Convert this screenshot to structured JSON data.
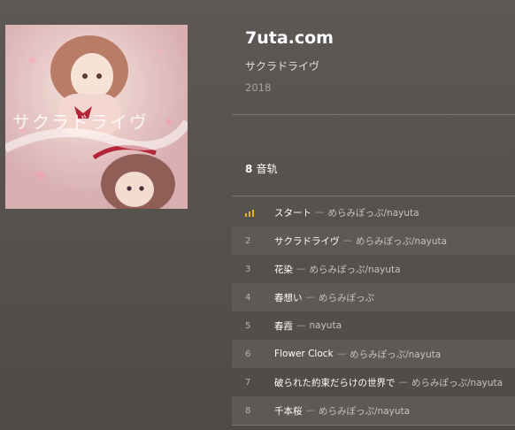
{
  "album": {
    "title": "7uta.com",
    "artist": "サクラドライヴ",
    "year": "2018",
    "cover_text": "サクラドライヴ"
  },
  "track_count": {
    "number": "8",
    "label": "音轨"
  },
  "tracks": [
    {
      "num": "",
      "playing": true,
      "name": "スタート",
      "sep": "—",
      "artist": "めらみぽっぷ/nayuta"
    },
    {
      "num": "2",
      "name": "サクラドライヴ",
      "sep": "—",
      "artist": "めらみぽっぷ/nayuta"
    },
    {
      "num": "3",
      "name": "花染",
      "sep": "—",
      "artist": "めらみぽっぷ/nayuta"
    },
    {
      "num": "4",
      "name": "春想い",
      "sep": "—",
      "artist": "めらみぽっぷ"
    },
    {
      "num": "5",
      "name": "春霞",
      "sep": "—",
      "artist": "nayuta"
    },
    {
      "num": "6",
      "name": "Flower Clock",
      "sep": "—",
      "artist": "めらみぽっぷ/nayuta"
    },
    {
      "num": "7",
      "name": "破られた約束だらけの世界で",
      "sep": "—",
      "artist": "めらみぽっぷ/nayuta"
    },
    {
      "num": "8",
      "name": "千本桜",
      "sep": "—",
      "artist": "めらみぽっぷ/nayuta"
    }
  ],
  "colors": {
    "accent": "#e4b31d",
    "background": "#585350"
  },
  "icons": {
    "now_playing": "equalizer-bars-icon"
  }
}
